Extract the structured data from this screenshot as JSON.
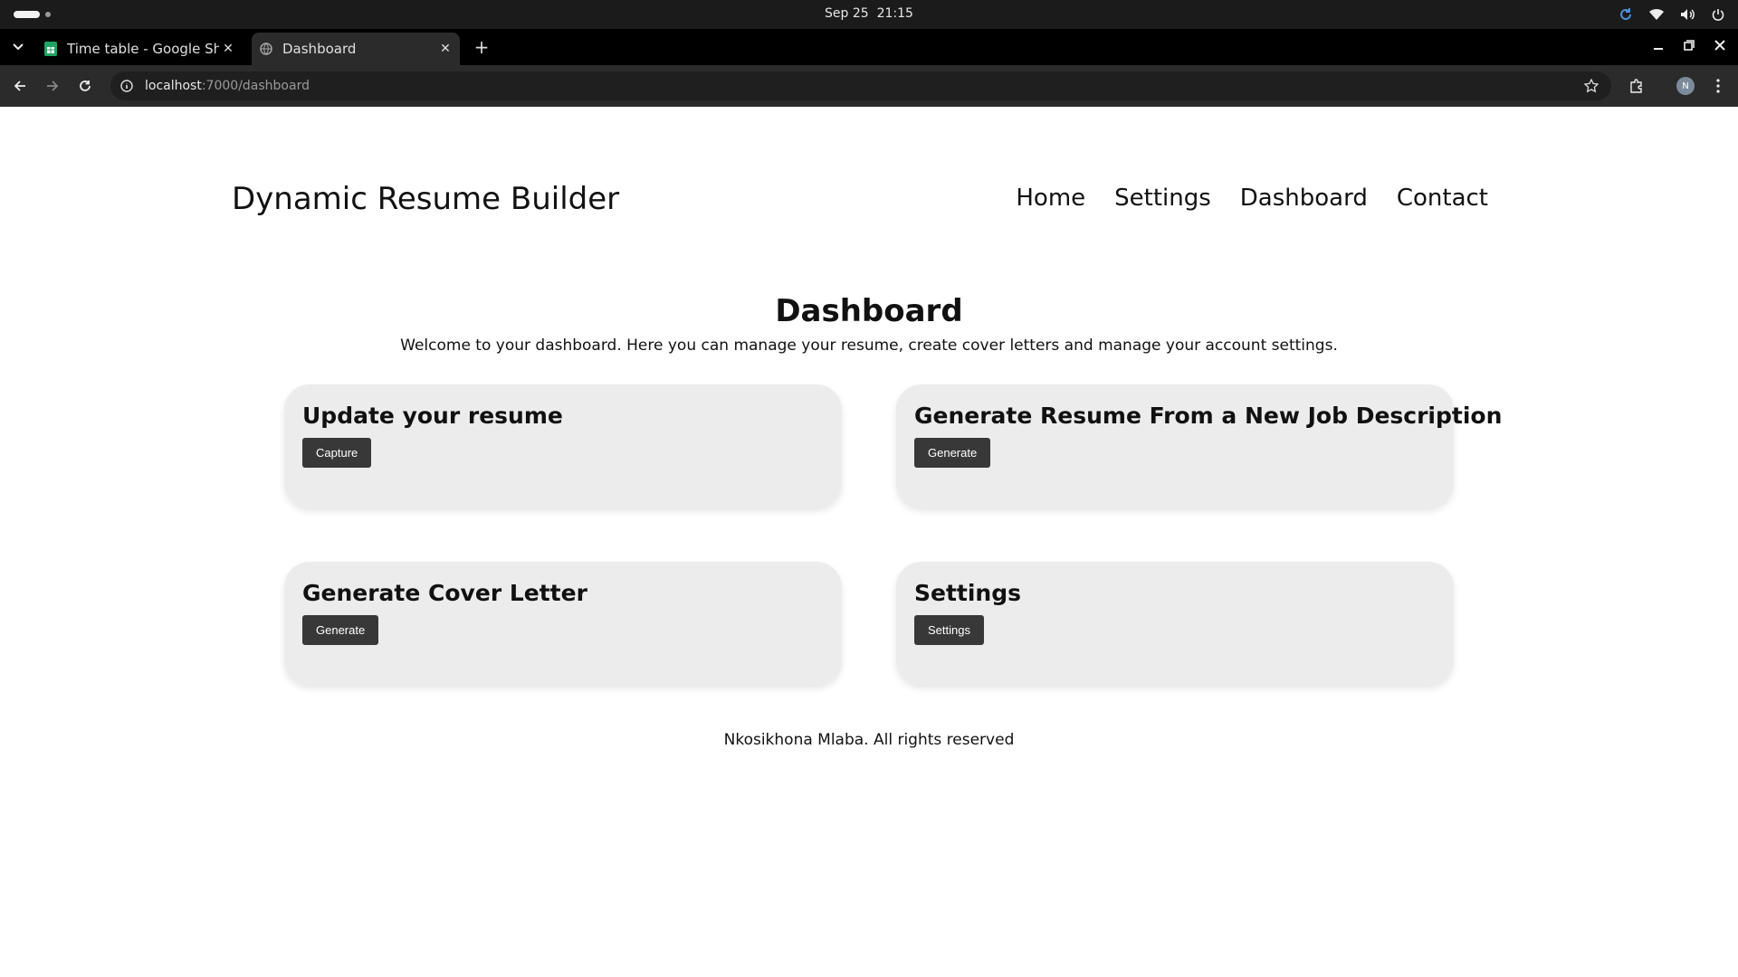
{
  "os": {
    "date": "Sep 25",
    "time": "21:15"
  },
  "browser": {
    "tabs": [
      {
        "title": "Time table - Google Shee",
        "icon": "google-sheets-icon",
        "active": false
      },
      {
        "title": "Dashboard",
        "icon": "globe-icon",
        "active": true
      }
    ],
    "url_host": "localhost",
    "url_path": ":7000/dashboard",
    "profile_initial": "N"
  },
  "site": {
    "title": "Dynamic Resume Builder",
    "nav": [
      "Home",
      "Settings",
      "Dashboard",
      "Contact"
    ]
  },
  "dashboard": {
    "title": "Dashboard",
    "subtitle": "Welcome to your dashboard. Here you can manage your resume, create cover letters and manage your account settings.",
    "cards": [
      {
        "title": "Update your resume",
        "button": "Capture"
      },
      {
        "title": "Generate Resume From a New Job Description",
        "button": "Generate"
      },
      {
        "title": "Generate Cover Letter",
        "button": "Generate"
      },
      {
        "title": "Settings",
        "button": "Settings"
      }
    ]
  },
  "footer": "Nkosikhona Mlaba. All rights reserved",
  "colors": {
    "card_bg": "#ececec",
    "button_bg": "#383838",
    "browser_dark": "#2b2b2b"
  }
}
